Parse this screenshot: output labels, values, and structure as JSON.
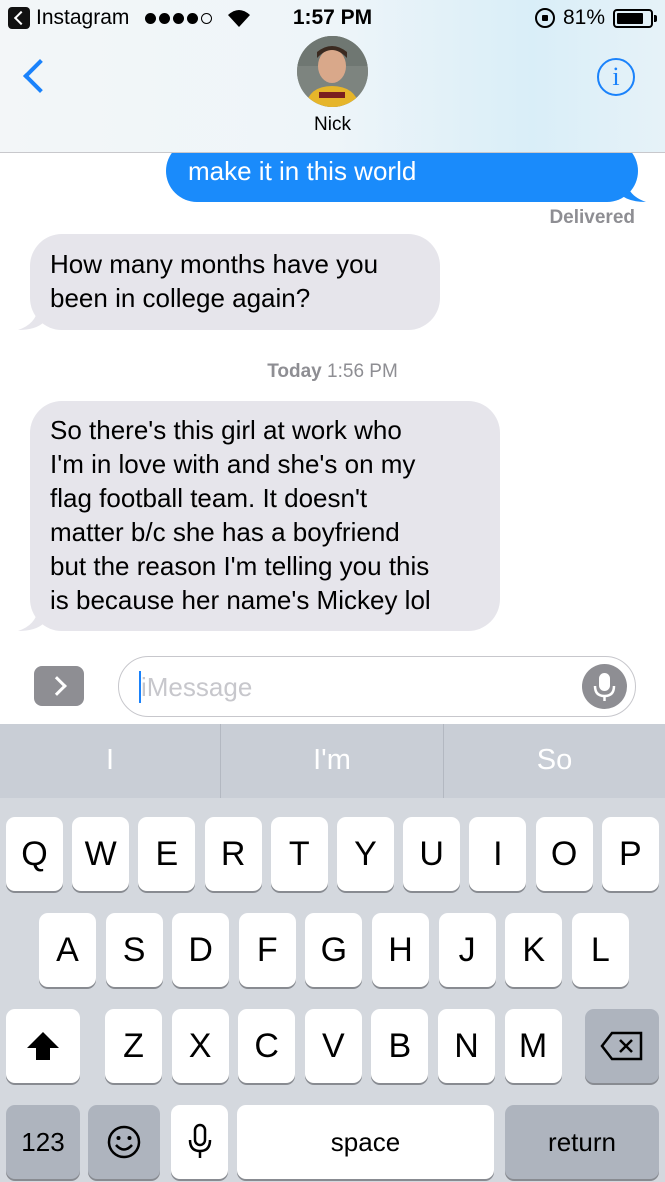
{
  "status_bar": {
    "back_app": "Instagram",
    "time": "1:57 PM",
    "battery": "81%",
    "battery_level": 0.81
  },
  "header": {
    "contact_name": "Nick",
    "icons": {
      "back": "chevron-left-icon",
      "info": "info-icon"
    },
    "info_glyph": "i"
  },
  "messages": {
    "outgoing_partial": "make it in this world",
    "delivered": "Delivered",
    "incoming_1": [
      "How many months have you",
      "been in college again?"
    ],
    "timestamp_day": "Today",
    "timestamp_time": "1:56 PM",
    "incoming_2": [
      "So there's this girl at work who",
      "I'm in love with and she's on my",
      "flag football team. It doesn't",
      "matter b/c she has a boyfriend",
      "but the reason I'm telling you this",
      "is because her name's Mickey lol"
    ]
  },
  "composer": {
    "placeholder": "iMessage"
  },
  "keyboard": {
    "predictions": [
      "I",
      "I'm",
      "So"
    ],
    "row1": [
      "Q",
      "W",
      "E",
      "R",
      "T",
      "Y",
      "U",
      "I",
      "O",
      "P"
    ],
    "row2": [
      "A",
      "S",
      "D",
      "F",
      "G",
      "H",
      "J",
      "K",
      "L"
    ],
    "row3": [
      "Z",
      "X",
      "C",
      "V",
      "B",
      "N",
      "M"
    ],
    "numbers": "123",
    "space": "space",
    "return": "return"
  },
  "colors": {
    "accent": "#1a82fb",
    "outgoing_bubble": "#1a8bfb",
    "incoming_bubble": "#e6e5eb"
  }
}
